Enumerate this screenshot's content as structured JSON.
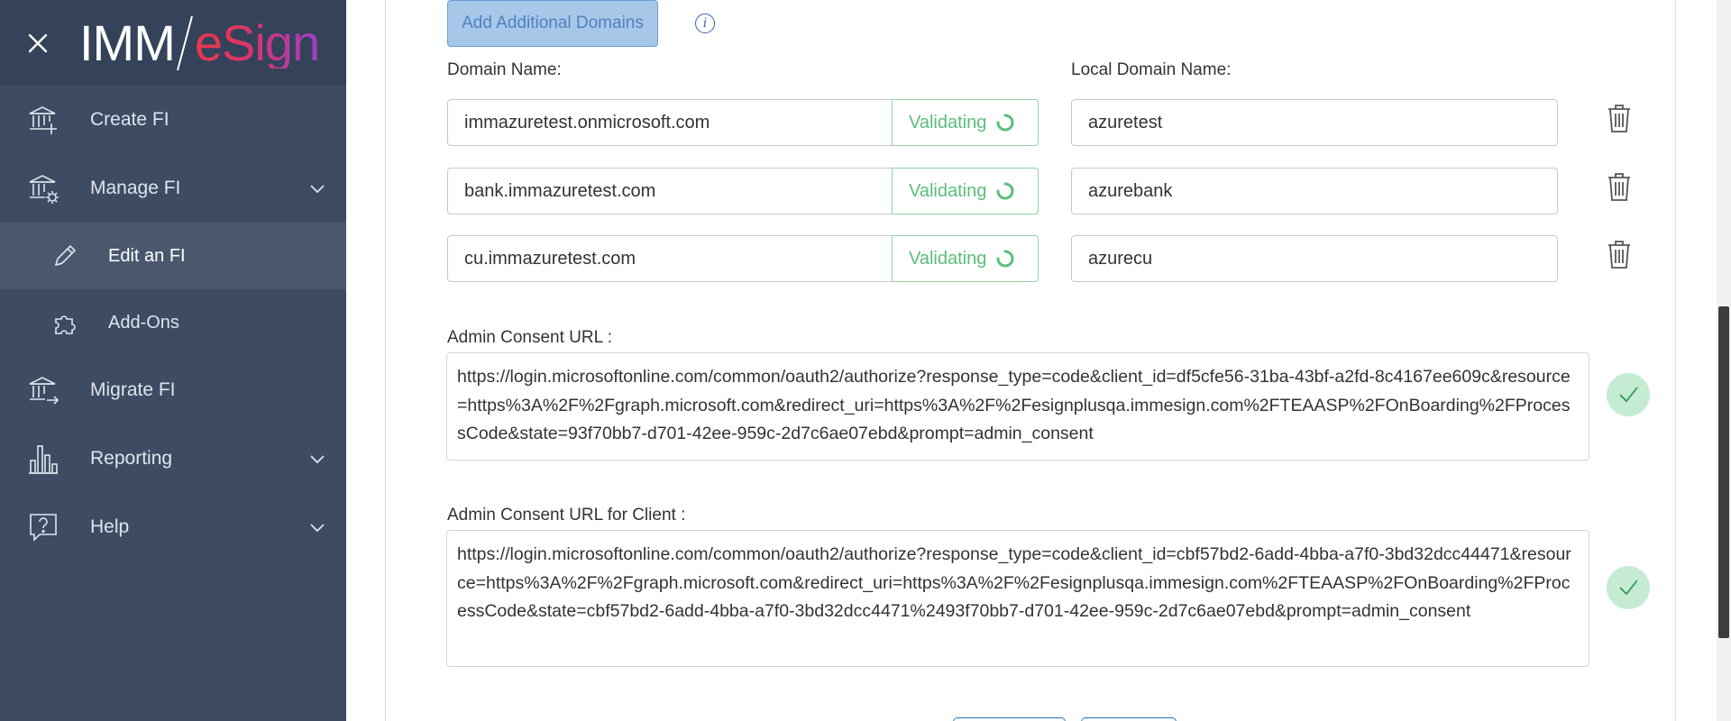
{
  "app": {
    "logo_imm": "IMM",
    "logo_esign": "eSign"
  },
  "sidebar": {
    "items": [
      {
        "label": "Create FI",
        "icon": "bank-plus-icon"
      },
      {
        "label": "Manage FI",
        "icon": "bank-gear-icon",
        "expandable": true
      },
      {
        "label": "Edit an FI",
        "icon": "pencil-icon",
        "sub": true,
        "active": true
      },
      {
        "label": "Add-Ons",
        "icon": "puzzle-icon",
        "sub": true
      },
      {
        "label": "Migrate FI",
        "icon": "bank-arrow-icon"
      },
      {
        "label": "Reporting",
        "icon": "bar-chart-icon",
        "expandable": true
      },
      {
        "label": "Help",
        "icon": "help-bubble-icon",
        "expandable": true
      }
    ]
  },
  "main": {
    "add_domains_label": "Add Additional Domains",
    "info_icon_glyph": "i",
    "domain_name_label": "Domain Name:",
    "local_domain_name_label": "Local Domain Name:",
    "validating_label": "Validating",
    "domains": [
      {
        "domain": "immazuretest.onmicrosoft.com",
        "local": "azuretest"
      },
      {
        "domain": "bank.immazuretest.com",
        "local": "azurebank"
      },
      {
        "domain": "cu.immazuretest.com",
        "local": "azurecu"
      }
    ],
    "admin_consent_label": "Admin Consent URL :",
    "admin_consent_url": "https://login.microsoftonline.com/common/oauth2/authorize?response_type=code&client_id=df5cfe56-31ba-43bf-a2fd-8c4167ee609c&resource=https%3A%2F%2Fgraph.microsoft.com&redirect_uri=https%3A%2F%2Fesignplusqa.immesign.com%2FTEAASP%2FOnBoarding%2FProcessCode&state=93f70bb7-d701-42ee-959c-2d7c6ae07ebd&prompt=admin_consent",
    "admin_consent_client_label": "Admin Consent URL for Client :",
    "admin_consent_client_url": "https://login.microsoftonline.com/common/oauth2/authorize?response_type=code&client_id=cbf57bd2-6add-4bba-a7f0-3bd32dcc44471&resource=https%3A%2F%2Fgraph.microsoft.com&redirect_uri=https%3A%2F%2Fesignplusqa.immesign.com%2FTEAASP%2FOnBoarding%2FProcessCode&state=cbf57bd2-6add-4bba-a7f0-3bd32dcc4471%2493f70bb7-d701-42ee-959c-2d7c6ae07ebd&prompt=admin_consent"
  },
  "colors": {
    "sidebar_bg": "#3d4c63",
    "sidebar_header_bg": "#34425a",
    "active_item_bg": "#4a586e",
    "validating_green": "#5cbd7a",
    "primary_blue": "#4f81bd",
    "check_bg": "#c5ecd3"
  }
}
